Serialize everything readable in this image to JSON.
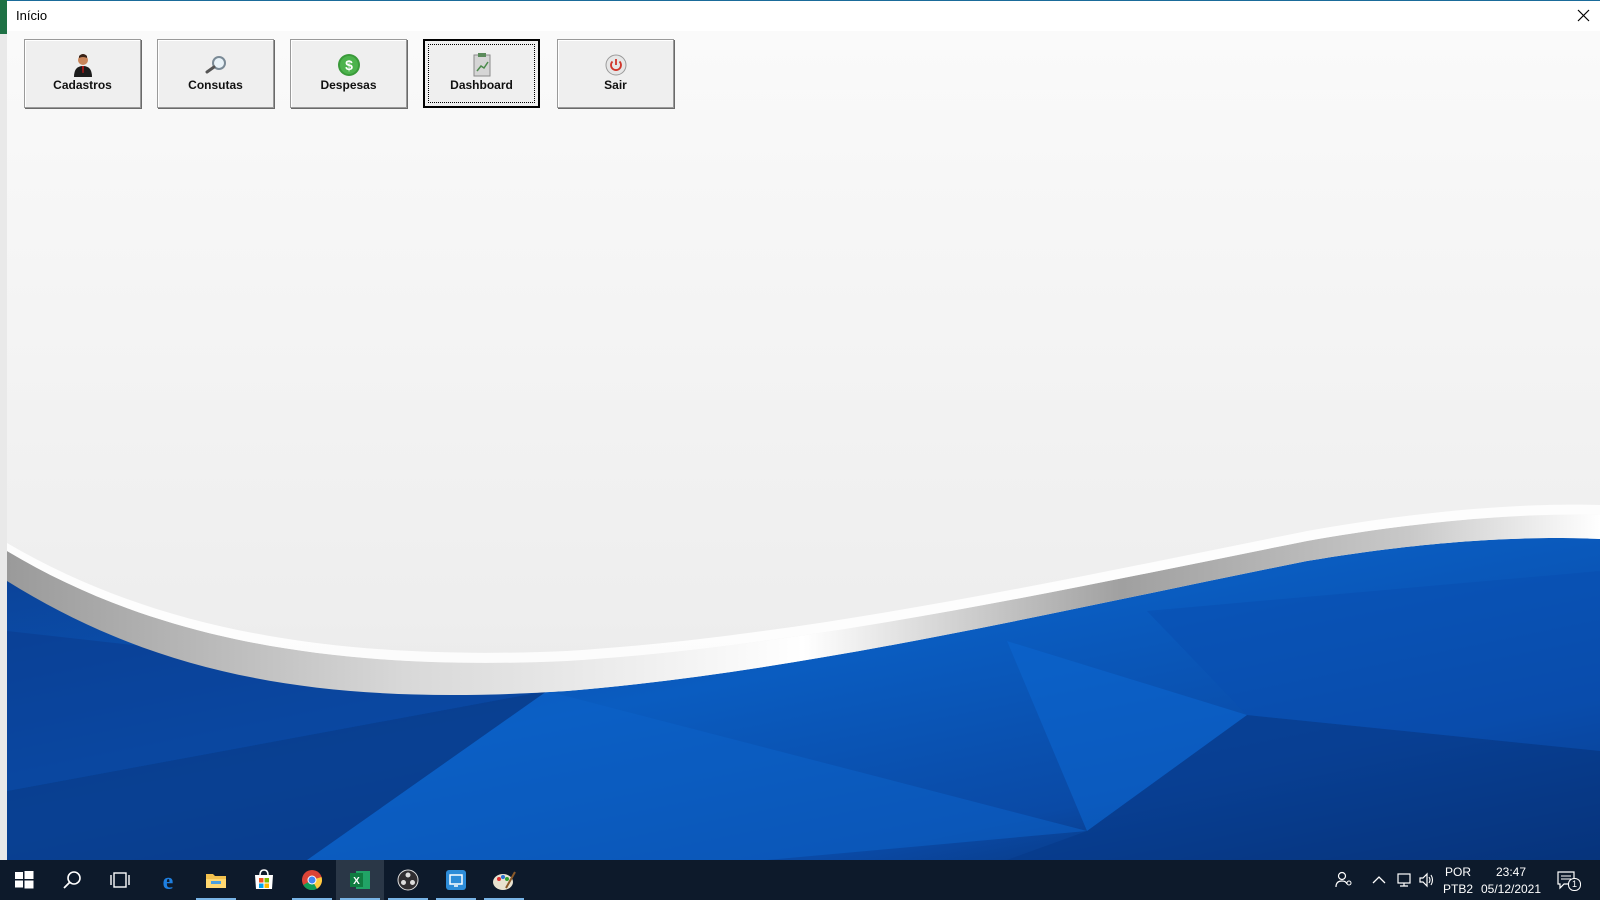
{
  "window": {
    "title": "Início"
  },
  "toolbar": {
    "buttons": [
      {
        "label": "Cadastros",
        "icon": "user-icon"
      },
      {
        "label": "Consutas",
        "icon": "magnifier-icon"
      },
      {
        "label": "Despesas",
        "icon": "dollar-coin-icon"
      },
      {
        "label": "Dashboard",
        "icon": "dashboard-clipboard-icon",
        "focused": true
      },
      {
        "label": "Sair",
        "icon": "power-icon"
      }
    ]
  },
  "taskbar": {
    "apps": [
      "start-icon",
      "search-icon",
      "task-view-icon",
      "edge-icon",
      "file-explorer-icon",
      "store-icon",
      "chrome-icon",
      "excel-icon",
      "obs-icon",
      "remote-icon",
      "paint-icon"
    ],
    "tray": {
      "language": "POR",
      "keyboard": "PTB2",
      "time": "23:47",
      "date": "05/12/2021",
      "notifications": "1"
    }
  },
  "colors": {
    "wave_blue": "#0b4fa8",
    "wave_dark": "#06245a",
    "taskbar": "#0d1a2b",
    "excel_green": "#1e7145"
  }
}
